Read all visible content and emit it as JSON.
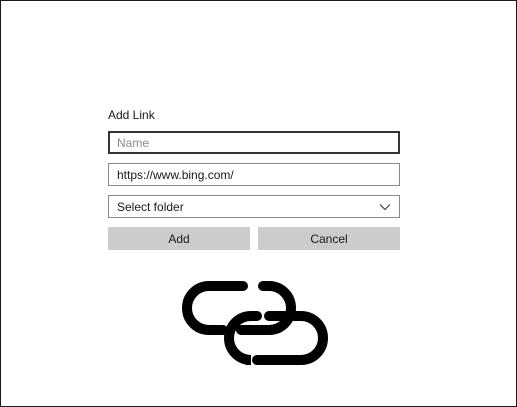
{
  "dialog": {
    "title": "Add Link",
    "name_placeholder": "Name",
    "url_value": "https://www.bing.com/",
    "folder_select": {
      "selected": "Select folder"
    },
    "add_label": "Add",
    "cancel_label": "Cancel"
  },
  "icons": {
    "illustration": "link-icon",
    "dropdown": "chevron-down-icon"
  },
  "colors": {
    "button_bg": "#cccccc",
    "border": "#8a8a8a",
    "focused_border": "#333333",
    "text": "#1a1a1a"
  }
}
